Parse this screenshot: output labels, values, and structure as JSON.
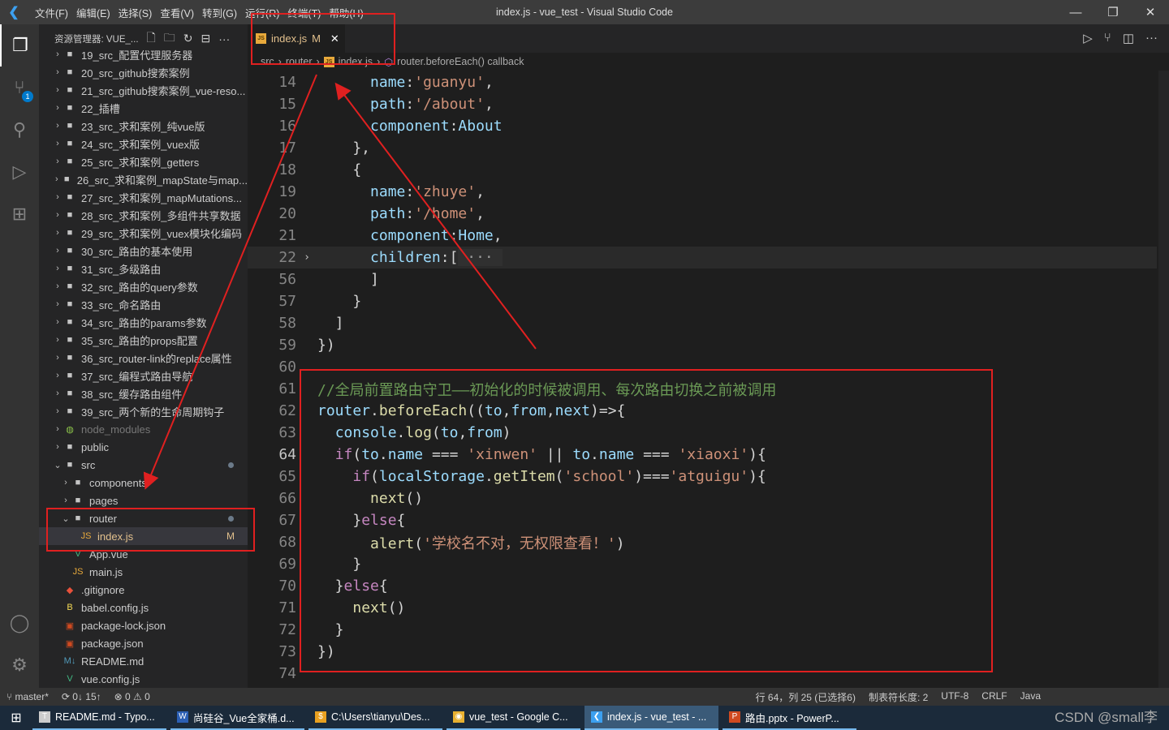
{
  "window": {
    "title": "index.js - vue_test - Visual Studio Code",
    "menu": [
      "文件(F)",
      "编辑(E)",
      "选择(S)",
      "查看(V)",
      "转到(G)",
      "运行(R)",
      "终端(T)",
      "帮助(H)"
    ]
  },
  "sidebar": {
    "title": "资源管理器: VUE_...",
    "items": [
      {
        "label": "19_src_配置代理服务器",
        "type": "folder",
        "depth": 0
      },
      {
        "label": "20_src_github搜索案例",
        "type": "folder",
        "depth": 0
      },
      {
        "label": "21_src_github搜索案例_vue-reso...",
        "type": "folder",
        "depth": 0
      },
      {
        "label": "22_插槽",
        "type": "folder",
        "depth": 0
      },
      {
        "label": "23_src_求和案例_纯vue版",
        "type": "folder",
        "depth": 0
      },
      {
        "label": "24_src_求和案例_vuex版",
        "type": "folder",
        "depth": 0
      },
      {
        "label": "25_src_求和案例_getters",
        "type": "folder",
        "depth": 0
      },
      {
        "label": "26_src_求和案例_mapState与map...",
        "type": "folder",
        "depth": 0
      },
      {
        "label": "27_src_求和案例_mapMutations...",
        "type": "folder",
        "depth": 0
      },
      {
        "label": "28_src_求和案例_多组件共享数据",
        "type": "folder",
        "depth": 0
      },
      {
        "label": "29_src_求和案例_vuex模块化编码",
        "type": "folder",
        "depth": 0
      },
      {
        "label": "30_src_路由的基本使用",
        "type": "folder",
        "depth": 0
      },
      {
        "label": "31_src_多级路由",
        "type": "folder",
        "depth": 0
      },
      {
        "label": "32_src_路由的query参数",
        "type": "folder",
        "depth": 0
      },
      {
        "label": "33_src_命名路由",
        "type": "folder",
        "depth": 0
      },
      {
        "label": "34_src_路由的params参数",
        "type": "folder",
        "depth": 0
      },
      {
        "label": "35_src_路由的props配置",
        "type": "folder",
        "depth": 0
      },
      {
        "label": "36_src_router-link的replace属性",
        "type": "folder",
        "depth": 0
      },
      {
        "label": "37_src_编程式路由导航",
        "type": "folder",
        "depth": 0
      },
      {
        "label": "38_src_缓存路由组件",
        "type": "folder",
        "depth": 0
      },
      {
        "label": "39_src_两个新的生命周期钩子",
        "type": "folder",
        "depth": 0
      },
      {
        "label": "node_modules",
        "type": "node",
        "depth": 0
      },
      {
        "label": "public",
        "type": "folder",
        "depth": 0
      },
      {
        "label": "src",
        "type": "open",
        "depth": 0,
        "dot": true
      },
      {
        "label": "components",
        "type": "folder",
        "depth": 1
      },
      {
        "label": "pages",
        "type": "folder",
        "depth": 1
      },
      {
        "label": "router",
        "type": "open",
        "depth": 1,
        "dot": true
      },
      {
        "label": "index.js",
        "type": "js",
        "depth": 2,
        "badge": "M",
        "selected": true
      },
      {
        "label": "App.vue",
        "type": "vue",
        "depth": 1
      },
      {
        "label": "main.js",
        "type": "js",
        "depth": 1
      },
      {
        "label": ".gitignore",
        "type": "git",
        "depth": 0
      },
      {
        "label": "babel.config.js",
        "type": "babel",
        "depth": 0
      },
      {
        "label": "package-lock.json",
        "type": "json",
        "depth": 0
      },
      {
        "label": "package.json",
        "type": "json",
        "depth": 0
      },
      {
        "label": "README.md",
        "type": "md",
        "depth": 0
      },
      {
        "label": "vue.config.js",
        "type": "vue",
        "depth": 0
      }
    ]
  },
  "tab": {
    "label": "index.js",
    "badge": "M"
  },
  "breadcrumb": [
    "src",
    "router",
    "index.js",
    "router.beforeEach() callback"
  ],
  "code": [
    {
      "n": "14",
      "t": [
        [
          "      ",
          "p"
        ],
        [
          "name",
          "v"
        ],
        [
          ":",
          "p"
        ],
        [
          "'guanyu'",
          "s"
        ],
        [
          ",",
          "p"
        ]
      ]
    },
    {
      "n": "15",
      "t": [
        [
          "      ",
          "p"
        ],
        [
          "path",
          "v"
        ],
        [
          ":",
          "p"
        ],
        [
          "'/about'",
          "s"
        ],
        [
          ",",
          "p"
        ]
      ]
    },
    {
      "n": "16",
      "t": [
        [
          "      ",
          "p"
        ],
        [
          "component",
          "v"
        ],
        [
          ":",
          "p"
        ],
        [
          "About",
          "v"
        ]
      ]
    },
    {
      "n": "17",
      "t": [
        [
          "    },",
          "p"
        ]
      ]
    },
    {
      "n": "18",
      "t": [
        [
          "    {",
          "p"
        ]
      ]
    },
    {
      "n": "19",
      "t": [
        [
          "      ",
          "p"
        ],
        [
          "name",
          "v"
        ],
        [
          ":",
          "p"
        ],
        [
          "'zhuye'",
          "s"
        ],
        [
          ",",
          "p"
        ]
      ]
    },
    {
      "n": "20",
      "t": [
        [
          "      ",
          "p"
        ],
        [
          "path",
          "v"
        ],
        [
          ":",
          "p"
        ],
        [
          "'/home'",
          "s"
        ],
        [
          ",",
          "p"
        ]
      ]
    },
    {
      "n": "21",
      "t": [
        [
          "      ",
          "p"
        ],
        [
          "component",
          "v"
        ],
        [
          ":",
          "p"
        ],
        [
          "Home",
          "v"
        ],
        [
          ",",
          "p"
        ]
      ]
    },
    {
      "n": "22",
      "t": [
        [
          "      ",
          "p"
        ],
        [
          "children",
          "v"
        ],
        [
          ":[",
          "p"
        ],
        [
          " ··· ",
          "fold"
        ]
      ],
      "folded": true
    },
    {
      "n": "56",
      "t": [
        [
          "      ]",
          "p"
        ]
      ]
    },
    {
      "n": "57",
      "t": [
        [
          "    }",
          "p"
        ]
      ]
    },
    {
      "n": "58",
      "t": [
        [
          "  ]",
          "p"
        ]
      ]
    },
    {
      "n": "59",
      "t": [
        [
          "})",
          "p"
        ]
      ]
    },
    {
      "n": "60",
      "t": []
    },
    {
      "n": "61",
      "t": [
        [
          "//全局前置路由守卫——初始化的时候被调用、每次路由切换之前被调用",
          "c"
        ]
      ]
    },
    {
      "n": "62",
      "t": [
        [
          "router",
          "v"
        ],
        [
          ".",
          "p"
        ],
        [
          "beforeEach",
          "f"
        ],
        [
          "((",
          "p"
        ],
        [
          "to",
          "v"
        ],
        [
          ",",
          "p"
        ],
        [
          "from",
          "v"
        ],
        [
          ",",
          "p"
        ],
        [
          "next",
          "v"
        ],
        [
          ")=>{",
          "p"
        ]
      ]
    },
    {
      "n": "63",
      "t": [
        [
          "  ",
          "p"
        ],
        [
          "console",
          "v"
        ],
        [
          ".",
          "p"
        ],
        [
          "log",
          "f"
        ],
        [
          "(",
          "p"
        ],
        [
          "to",
          "v"
        ],
        [
          ",",
          "p"
        ],
        [
          "from",
          "v"
        ],
        [
          ")",
          "p"
        ]
      ]
    },
    {
      "n": "64",
      "t": [
        [
          "  ",
          "p"
        ],
        [
          "if",
          "k"
        ],
        [
          "(",
          "p"
        ],
        [
          "to",
          "v"
        ],
        [
          ".",
          "p"
        ],
        [
          "name",
          "v"
        ],
        [
          " === ",
          "p"
        ],
        [
          "'xinwen'",
          "s"
        ],
        [
          " || ",
          "p"
        ],
        [
          "to",
          "v"
        ],
        [
          ".",
          "p"
        ],
        [
          "name",
          "v"
        ],
        [
          " === ",
          "p"
        ],
        [
          "'xiaoxi'",
          "s"
        ],
        [
          "){",
          "p"
        ]
      ],
      "current": true
    },
    {
      "n": "65",
      "t": [
        [
          "    ",
          "p"
        ],
        [
          "if",
          "k"
        ],
        [
          "(",
          "p"
        ],
        [
          "localStorage",
          "v"
        ],
        [
          ".",
          "p"
        ],
        [
          "getItem",
          "f"
        ],
        [
          "(",
          "p"
        ],
        [
          "'school'",
          "s"
        ],
        [
          ")===",
          "p"
        ],
        [
          "'atguigu'",
          "s"
        ],
        [
          "){",
          "p"
        ]
      ]
    },
    {
      "n": "66",
      "t": [
        [
          "      ",
          "p"
        ],
        [
          "next",
          "f"
        ],
        [
          "()",
          "p"
        ]
      ]
    },
    {
      "n": "67",
      "t": [
        [
          "    }",
          "p"
        ],
        [
          "else",
          "k"
        ],
        [
          "{",
          "p"
        ]
      ]
    },
    {
      "n": "68",
      "t": [
        [
          "      ",
          "p"
        ],
        [
          "alert",
          "f"
        ],
        [
          "(",
          "p"
        ],
        [
          "'学校名不对，无权限查看！'",
          "s"
        ],
        [
          ")",
          "p"
        ]
      ]
    },
    {
      "n": "69",
      "t": [
        [
          "    }",
          "p"
        ]
      ]
    },
    {
      "n": "70",
      "t": [
        [
          "  }",
          "p"
        ],
        [
          "else",
          "k"
        ],
        [
          "{",
          "p"
        ]
      ]
    },
    {
      "n": "71",
      "t": [
        [
          "    ",
          "p"
        ],
        [
          "next",
          "f"
        ],
        [
          "()",
          "p"
        ]
      ]
    },
    {
      "n": "72",
      "t": [
        [
          "  }",
          "p"
        ]
      ]
    },
    {
      "n": "73",
      "t": [
        [
          "})",
          "p"
        ]
      ]
    },
    {
      "n": "74",
      "t": []
    }
  ],
  "status": {
    "branch": "master*",
    "sync": "0↓ 15↑",
    "problems": "⊗ 0 ⚠ 0",
    "position": "行 64，列 25 (已选择6)",
    "indent": "制表符长度: 2",
    "encoding": "UTF-8",
    "eol": "CRLF",
    "language": "Java"
  },
  "taskbar": [
    {
      "label": "README.md - Typo...",
      "icon": "T",
      "color": "#ccc"
    },
    {
      "label": "尚硅谷_Vue全家桶.d...",
      "icon": "W",
      "color": "#2b5fb4"
    },
    {
      "label": "C:\\Users\\tianyu\\Des...",
      "icon": "$",
      "color": "#e8a020"
    },
    {
      "label": "vue_test - Google C...",
      "icon": "◉",
      "color": "#e8b030"
    },
    {
      "label": "index.js - vue_test - ...",
      "icon": "❮",
      "color": "#3ca0f0",
      "active": true
    },
    {
      "label": "路由.pptx - PowerP...",
      "icon": "P",
      "color": "#d04a20"
    }
  ],
  "watermark": "CSDN @small李"
}
